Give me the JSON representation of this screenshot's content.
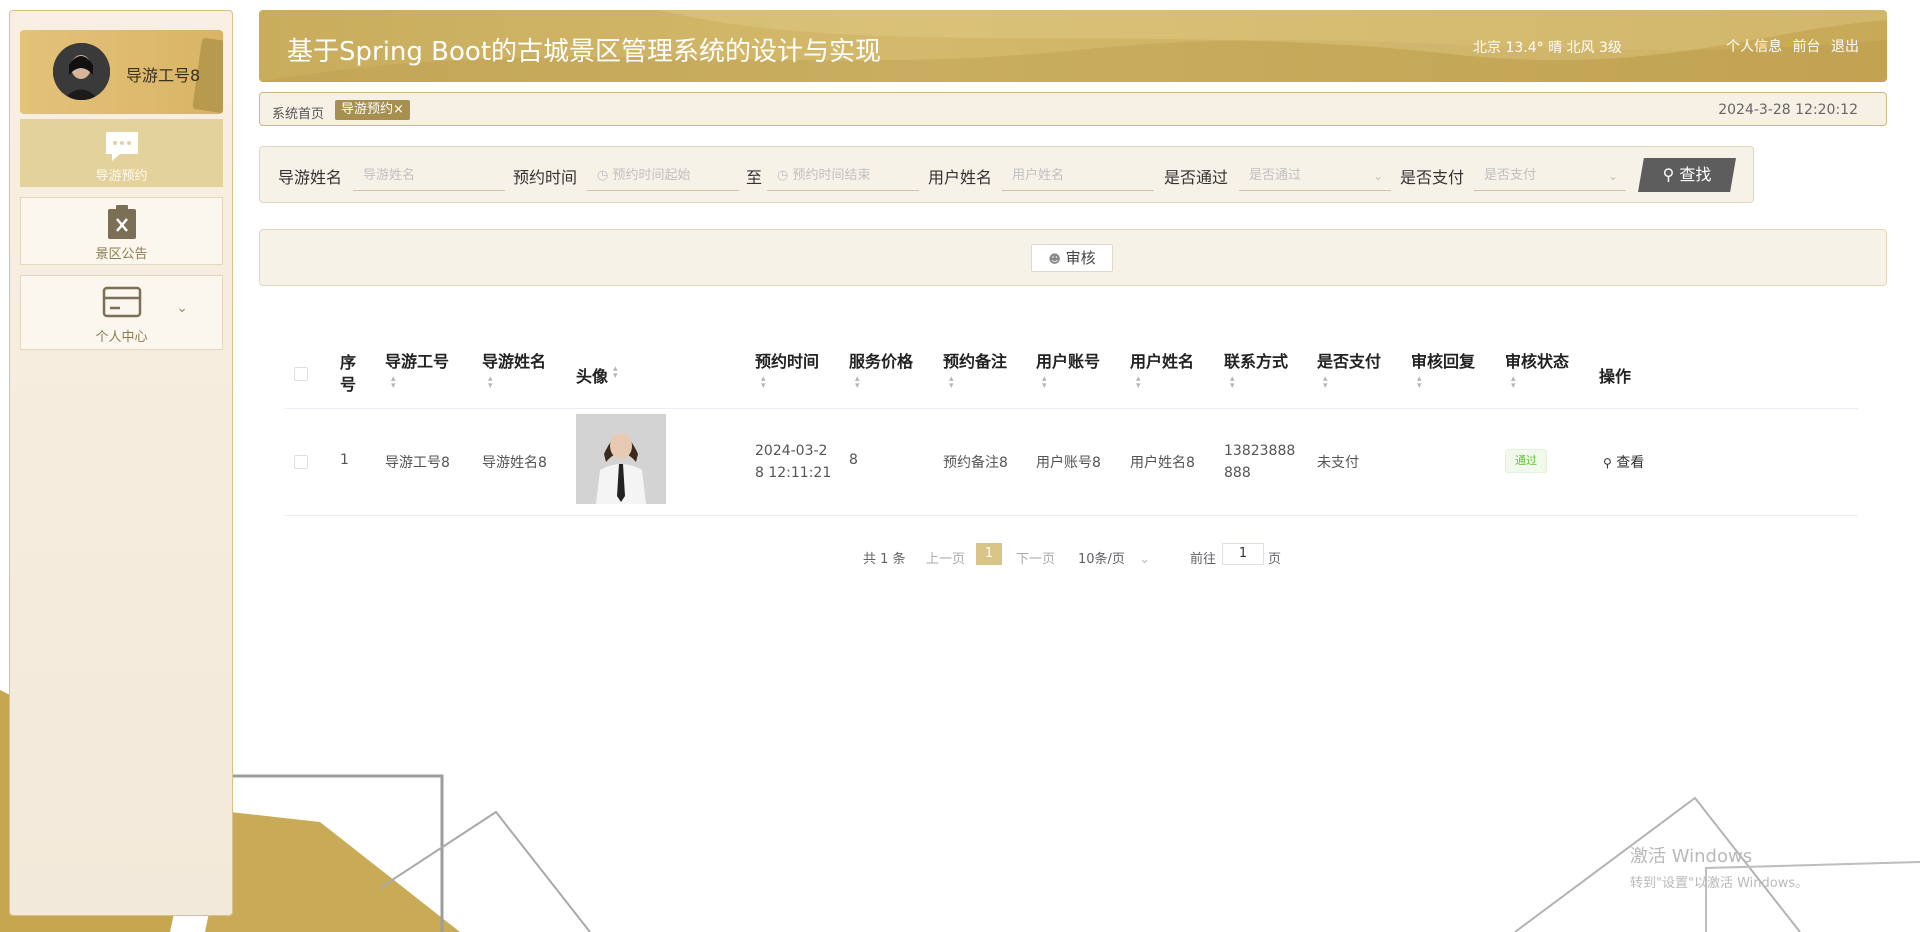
{
  "sidebar": {
    "profile": {
      "name": "导游工号8"
    },
    "menu": [
      {
        "label": "导游预约",
        "icon": "chat-icon",
        "active": true
      },
      {
        "label": "景区公告",
        "icon": "clipboard-icon",
        "active": false
      },
      {
        "label": "个人中心",
        "icon": "card-icon",
        "active": false
      }
    ]
  },
  "header": {
    "title": "基于Spring Boot的古城景区管理系统的设计与实现",
    "weather": "北京  13.4°  晴  北风  3级",
    "links": [
      "个人信息",
      "前台",
      "退出"
    ]
  },
  "breadcrumb": {
    "home": "系统首页",
    "tag": "导游预约",
    "datetime": "2024-3-28 12:20:12"
  },
  "search": {
    "fields": [
      {
        "label": "导游姓名",
        "placeholder": "导游姓名"
      },
      {
        "label": "预约时间",
        "placeholder": "预约时间起始"
      },
      {
        "label": "至",
        "placeholder": "预约时间结束"
      },
      {
        "label": "用户姓名",
        "placeholder": "用户姓名"
      },
      {
        "label": "是否通过",
        "placeholder": "是否通过"
      },
      {
        "label": "是否支付",
        "placeholder": "是否支付"
      }
    ],
    "button": "查找"
  },
  "actions": {
    "review": "审核"
  },
  "table": {
    "columns": [
      "序号",
      "导游工号",
      "导游姓名",
      "头像",
      "预约时间",
      "服务价格",
      "预约备注",
      "用户账号",
      "用户姓名",
      "联系方式",
      "是否支付",
      "审核回复",
      "审核状态",
      "操作"
    ],
    "rows": [
      {
        "index": "1",
        "guide_no": "导游工号8",
        "guide_name": "导游姓名8",
        "time_line1": "2024-03-2",
        "time_line2": "8 12:11:21",
        "price": "8",
        "remark": "预约备注8",
        "user_account": "用户账号8",
        "user_name": "用户姓名8",
        "phone_line1": "13823888",
        "phone_line2": "888",
        "paid": "未支付",
        "reply": "",
        "status": "通过",
        "action": "查看"
      }
    ]
  },
  "pagination": {
    "total": "共 1 条",
    "prev": "上一页",
    "current": "1",
    "next": "下一页",
    "page_size": "10条/页",
    "goto": "前往",
    "goto_value": "1",
    "page_unit": "页"
  },
  "watermark": {
    "line1": "激活 Windows",
    "line2": "转到\"设置\"以激活 Windows。"
  },
  "colors": {
    "accent": "#c9ad5d",
    "sidebar_bg": "#f8efe2",
    "active_menu": "#e4d29d",
    "button_dark": "#5d5d5d",
    "status_pass": "#67c23a"
  }
}
